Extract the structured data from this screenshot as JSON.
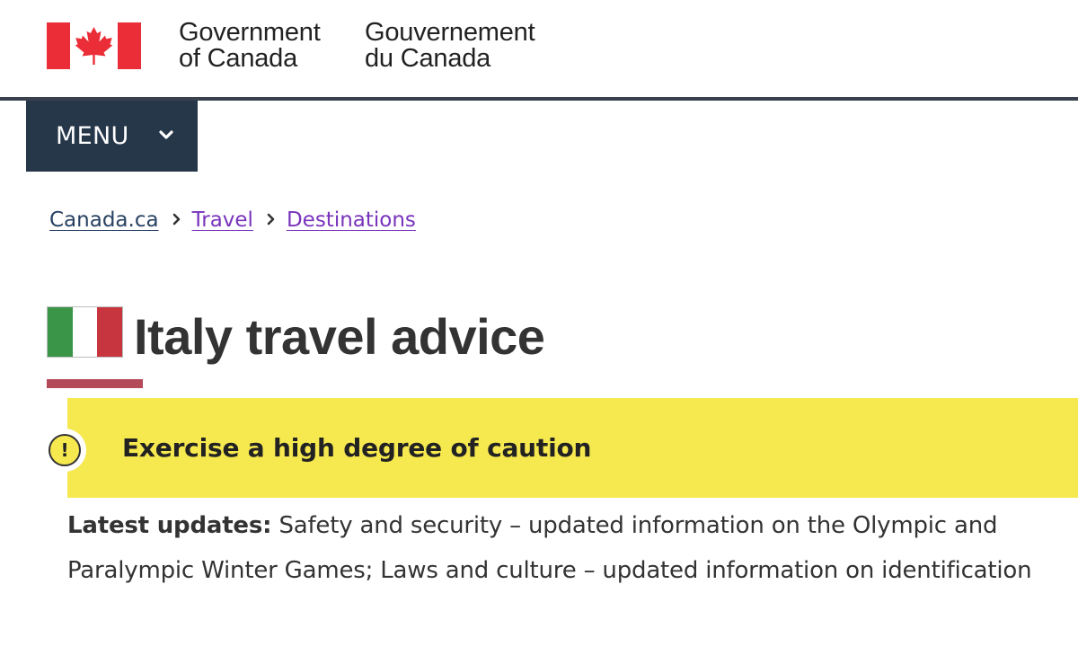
{
  "header": {
    "wordmark_en": [
      "Government",
      "of Canada"
    ],
    "wordmark_fr": [
      "Gouvernement",
      "du Canada"
    ],
    "flag_icon": "canada-flag-icon",
    "colors": {
      "flag_red": "#eb2d37",
      "rule": "#38414d"
    }
  },
  "menu": {
    "label": "MENU",
    "icon": "chevron-down-icon",
    "color": "#26374a"
  },
  "breadcrumb": {
    "items": [
      "Canada.ca",
      "Travel",
      "Destinations"
    ],
    "separator_icon": "chevron-right-icon",
    "colors": {
      "home": "#284162",
      "link": "#7834bc"
    }
  },
  "page": {
    "flag_icon": "italy-flag-icon",
    "flag_colors": [
      "#3a9548",
      "#ffffff",
      "#c7363f"
    ],
    "title": "Italy travel advice",
    "underline_color": "#a62a3d"
  },
  "advisory": {
    "icon": "exclamation-icon",
    "level": "Exercise a high degree of caution",
    "color": "#f6e84f"
  },
  "updates": {
    "label": "Latest updates:",
    "text": "Safety and security – updated information on the Olympic and Paralympic Winter Games; Laws and culture – updated information on identification"
  }
}
